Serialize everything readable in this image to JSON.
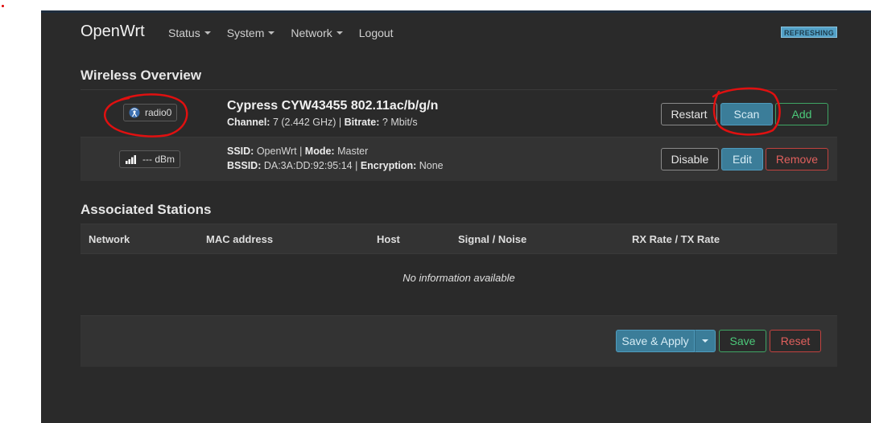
{
  "app": {
    "brand": "OpenWrt",
    "status_badge": "REFRESHING"
  },
  "nav": {
    "items": [
      {
        "label": "Status"
      },
      {
        "label": "System"
      },
      {
        "label": "Network"
      },
      {
        "label": "Logout"
      }
    ]
  },
  "wireless": {
    "title": "Wireless Overview",
    "radio": {
      "badge": "radio0",
      "name": "Cypress CYW43455 802.11ac/b/g/n",
      "channel_label": "Channel:",
      "channel_value": " 7 (2.442 GHz) | ",
      "bitrate_label": "Bitrate:",
      "bitrate_value": " ? Mbit/s",
      "buttons": {
        "restart": "Restart",
        "scan": "Scan",
        "add": "Add"
      }
    },
    "network": {
      "signal": "--- dBm",
      "ssid_label": "SSID:",
      "ssid_value": " OpenWrt | ",
      "mode_label": "Mode:",
      "mode_value": " Master",
      "bssid_label": "BSSID:",
      "bssid_value": " DA:3A:DD:92:95:14 | ",
      "enc_label": "Encryption:",
      "enc_value": " None",
      "buttons": {
        "disable": "Disable",
        "edit": "Edit",
        "remove": "Remove"
      }
    }
  },
  "stations": {
    "title": "Associated Stations",
    "columns": [
      "Network",
      "MAC address",
      "Host",
      "Signal / Noise",
      "RX Rate / TX Rate"
    ],
    "empty": "No information available"
  },
  "footer": {
    "save_apply": "Save & Apply",
    "save": "Save",
    "reset": "Reset"
  },
  "colors": {
    "background": "#2a2a2a",
    "accent_blue": "#3b7d99",
    "green": "#4cc97a",
    "red": "#e0605d",
    "annotation": "#e01010"
  }
}
